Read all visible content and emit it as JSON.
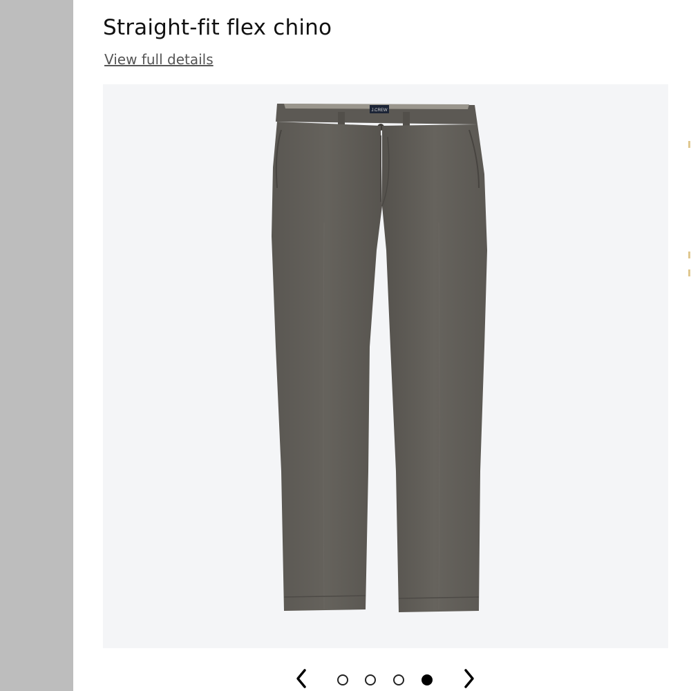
{
  "product": {
    "title": "Straight-fit flex chino",
    "details_link": "View full details",
    "image_alt": "Gray straight-fit chino pants",
    "brand_tag_text": "J.CREW"
  },
  "carousel": {
    "prev_icon": "chevron-left-icon",
    "next_icon": "chevron-right-icon",
    "slide_count": 4,
    "active_slide": 4
  },
  "colors": {
    "gutter": "#bdbdbd",
    "image_background": "#f4f5f7",
    "pants": "#5f5c57",
    "title_text": "#111111",
    "link_text": "#555555"
  }
}
